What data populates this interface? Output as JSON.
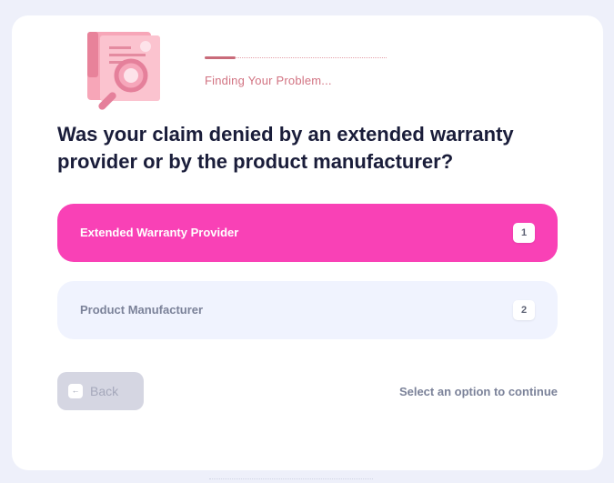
{
  "progress": {
    "status": "Finding Your Problem...",
    "fraction": 0.17
  },
  "question": {
    "text": "Was your claim denied by an extended warranty provider or by the product manufacturer?"
  },
  "options": [
    {
      "label": "Extended Warranty Provider",
      "key": "1",
      "selected": true
    },
    {
      "label": "Product Manufacturer",
      "key": "2",
      "selected": false
    }
  ],
  "navigation": {
    "back_label": "Back",
    "hint": "Select an option to continue"
  },
  "colors": {
    "accent": "#f941b6",
    "unselected_option": "#f0f3fe",
    "progress_text": "#d27382",
    "question_text": "#1a1d3a"
  },
  "icons": {
    "illustration": "document-magnifier-illustration",
    "back": "arrow-left-icon"
  }
}
